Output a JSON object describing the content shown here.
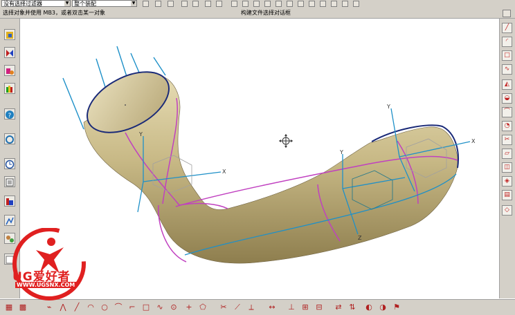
{
  "toolbar": {
    "filter_combo": "没有选择过滤器",
    "assembly_combo": "整个装配"
  },
  "status": {
    "prompt": "选择对象并使用 MB3，或者双击某一对象",
    "message": "构建文件选择对话框"
  },
  "logo": {
    "brand": "UG爱好者",
    "url": "WWW.UGSNX.COM"
  },
  "axis_labels": {
    "x": "X",
    "y": "Y",
    "z": "Z"
  },
  "colors": {
    "pipe_fill": "#c8b986",
    "pipe_edge": "#1a2a78",
    "curve_magenta": "#c040c0",
    "curve_cyan": "#1e90c8",
    "logo_red": "#e02020"
  },
  "icons": {
    "left": [
      "assembly-icon",
      "constraint-icon",
      "component-icon",
      "palette-icon",
      "help-icon",
      "history-icon",
      "clock-icon",
      "list-icon",
      "measure-icon",
      "analysis-icon",
      "role-icon",
      "browser-icon"
    ],
    "right": [
      "line-icon",
      "arc-icon",
      "rectangle-icon",
      "spline-icon",
      "extrude-icon",
      "revolve-icon",
      "sweep-icon",
      "blend-icon",
      "trim-icon",
      "offset-icon",
      "mirror-icon",
      "pattern-icon",
      "feature-icon",
      "shell-icon",
      "draft-icon",
      "edge-blend-icon",
      "chamfer-icon",
      "book-icon"
    ]
  }
}
